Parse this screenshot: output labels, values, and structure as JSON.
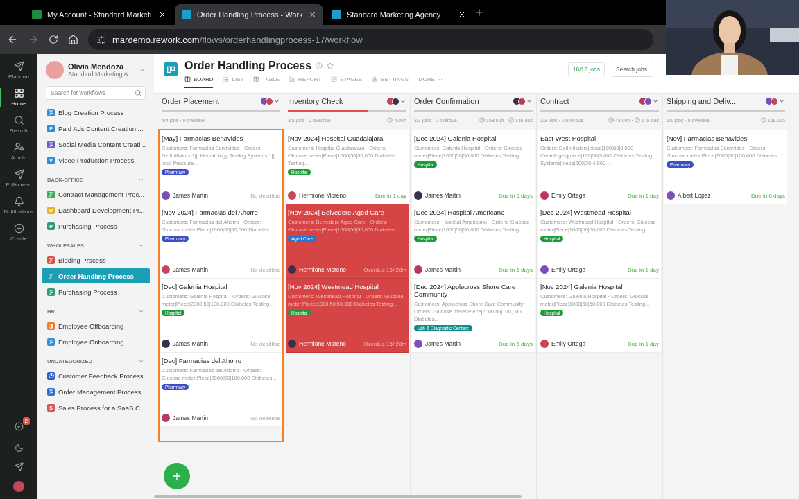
{
  "browser": {
    "tabs": [
      {
        "title": "My Account - Standard Marketi",
        "color": "#1e8e3e",
        "selected": false
      },
      {
        "title": "Order Handling Process - Work",
        "color": "#1a9fc9",
        "selected": true
      },
      {
        "title": "Standard Marketing Agency",
        "color": "#1a9fc9",
        "selected": false
      }
    ],
    "url_host": "mardemo.rework.com",
    "url_path": "/flows/orderhandlingprocess-17/workflow"
  },
  "rail": {
    "items": [
      {
        "label": "Platform",
        "kind": "send",
        "selected": false
      },
      {
        "label": "Home",
        "kind": "grid",
        "selected": true
      },
      {
        "label": "Search",
        "kind": "search",
        "selected": false
      },
      {
        "label": "Admin",
        "kind": "admin",
        "selected": false
      },
      {
        "label": "Fullscreen",
        "kind": "flag",
        "selected": false
      },
      {
        "label": "Notifications",
        "kind": "bell",
        "selected": false
      },
      {
        "label": "Create",
        "kind": "plus",
        "selected": false
      }
    ],
    "bottom": {
      "tasks_badge": "2"
    }
  },
  "sidebar": {
    "user": {
      "name": "Olivia Mendoza",
      "org": "Standard Marketing A..."
    },
    "search": {
      "placeholder": "Search for workflows"
    },
    "groups": [
      {
        "items": [
          {
            "label": "Blog Creation Process",
            "kind": "board",
            "color": "#2f8fd8",
            "selected": false
          },
          {
            "label": "Paid Ads Content Creation ...",
            "kind": "letter",
            "letter": "P",
            "color": "#2f8fd8",
            "selected": false
          },
          {
            "label": "Social Media Content Creati...",
            "kind": "board",
            "color": "#6e5cc8",
            "selected": false
          },
          {
            "label": "Video Production Process",
            "kind": "letter",
            "letter": "V",
            "color": "#2f8fd8",
            "selected": false
          }
        ]
      },
      {
        "title": "BACK-OFFICE",
        "items": [
          {
            "label": "Contract Management Proc...",
            "kind": "board",
            "color": "#3fae5a",
            "selected": false
          },
          {
            "label": "Dashboard Development Pr...",
            "kind": "letter",
            "letter": "D",
            "color": "#e6b420",
            "selected": false
          },
          {
            "label": "Purchasing Process",
            "kind": "letter",
            "letter": "P",
            "color": "#2a9d7e",
            "selected": false
          }
        ]
      },
      {
        "title": "WHOLESALES",
        "items": [
          {
            "label": "Bidding Process",
            "kind": "board",
            "color": "#d9534f",
            "selected": false
          },
          {
            "label": "Order Handling Process",
            "kind": "board",
            "color": "#1a9fb5",
            "selected": true
          },
          {
            "label": "Purchasing Process",
            "kind": "board",
            "color": "#2a9d7e",
            "selected": false
          }
        ]
      },
      {
        "title": "HR",
        "items": [
          {
            "label": "Employee Offboarding",
            "kind": "half",
            "color": "#f07a22",
            "selected": false
          },
          {
            "label": "Employee Onboarding",
            "kind": "board",
            "color": "#2f8fd8",
            "selected": false
          }
        ]
      },
      {
        "title": "UNCATEGORIZED",
        "items": [
          {
            "label": "Customer Feedback Process",
            "kind": "person",
            "color": "#2d5bb8",
            "selected": false
          },
          {
            "label": "Order Management Process",
            "kind": "board",
            "color": "#2d6fd0",
            "selected": false
          },
          {
            "label": "Sales Process for a SaaS C...",
            "kind": "letter",
            "letter": "S",
            "color": "#d9534f",
            "selected": false
          }
        ]
      }
    ]
  },
  "header": {
    "title": "Order Handling Process",
    "jobs_count": "16/16 jobs",
    "search": {
      "placeholder": "Search jobs"
    },
    "tabs": [
      {
        "label": "BOARD",
        "kind": "board",
        "selected": true
      },
      {
        "label": "LIST",
        "kind": "list",
        "selected": false
      },
      {
        "label": "TABLE",
        "kind": "table",
        "selected": false
      },
      {
        "label": "REPORT",
        "kind": "report",
        "selected": false
      },
      {
        "label": "STAGES",
        "kind": "stages",
        "selected": false
      },
      {
        "label": "SETTINGS",
        "kind": "gear",
        "selected": false
      },
      {
        "label": "MORE",
        "kind": "caret",
        "selected": false
      }
    ]
  },
  "columns": [
    {
      "title": "Order Placement",
      "highlighted": true,
      "jobs": "4/4 jobs · 0 overdue",
      "cards": [
        {
          "title": "[May] Farmacias Benavides",
          "summary": "Customers: Farmacias Benavides · Orders: Defibrillators|1||| Hematology Testing Systems|1||| lood Pressure...",
          "tag": {
            "label": "Pharmacy",
            "color": "#3d4fc4"
          },
          "assignee": "James Martin",
          "due": {
            "text": "No deadline",
            "kind": "none"
          },
          "overdue": false
        },
        {
          "title": "[Nov 2024] Farmacias del Ahorro",
          "summary": "Customers: Farmacias del Ahorro · Orders: Glucose meter|Piece|1000|50|50,000 Diabetes...",
          "tag": {
            "label": "Pharmacy",
            "color": "#3d4fc4"
          },
          "assignee": "James Martin",
          "due": {
            "text": "No deadline",
            "kind": "none"
          },
          "overdue": false
        },
        {
          "title": "[Dec] Galenia Hospital",
          "summary": "Customers: Galenia Hospital · Orders: Glucose meter|Piece|2000|50|100,000 Diabetes Testing...",
          "tag": {
            "label": "Hospital",
            "color": "#1f9a3a"
          },
          "assignee": "James Martin",
          "due": {
            "text": "No deadline",
            "kind": "none"
          },
          "overdue": false
        },
        {
          "title": "[Dec] Farmacias del Ahorro",
          "summary": "Customers: Farmacias del Ahorro · Orders: Glucose meter|Piece|2000|50|100,000 Diabetes...",
          "tag": {
            "label": "Pharmacy",
            "color": "#3d4fc4"
          },
          "assignee": "James Martin",
          "due": {
            "text": "No deadline",
            "kind": "none"
          },
          "overdue": false
        }
      ]
    },
    {
      "title": "Inventory Check",
      "highlighted": false,
      "progress": {
        "level": 0.67
      },
      "jobs": "3/3 jobs · 2 overdue",
      "hours": "4.00h",
      "cards": [
        {
          "title": "[Nov 2024] Hospital Guadalajara",
          "summary": "Customers: Hospital Guadalajara · Orders: Glucose meter|Piece|1000|50|50,000 Diabetes Testing...",
          "tag": {
            "label": "Hospital",
            "color": "#1f9a3a"
          },
          "assignee": "Hermione Moreno",
          "due": {
            "text": "Due in 1 day",
            "kind": "due"
          },
          "overdue": false
        },
        {
          "title": "[Nov 2024] Belvedere Aged Care",
          "summary": "Customers: Belvedere Aged Care · Orders: Glucose meter|Piece|1000|50|50,000 Diabetes...",
          "tag": {
            "label": "Aged Care",
            "color": "#1f78d1"
          },
          "assignee": "Hermione Moreno",
          "due": {
            "text": "Overdue 16h28m",
            "kind": "overdue"
          },
          "overdue": true
        },
        {
          "title": "[Nov 2024] Westmead Hospital",
          "summary": "Customers: Westmead Hospital · Orders: Glucose meter|Piece|1000|50|50,000 Diabetes Testing...",
          "tag": {
            "label": "Hospital",
            "color": "#1f9a3a"
          },
          "assignee": "Hermione Moreno",
          "due": {
            "text": "Overdue 16h28m",
            "kind": "overdue"
          },
          "overdue": true
        }
      ]
    },
    {
      "title": "Order Confirmation",
      "highlighted": false,
      "jobs": "3/3 jobs · 0 overdue",
      "hours": "168.00h ·",
      "todos": "1 to-dos",
      "cards": [
        {
          "title": "[Dec 2024] Galenia Hospital",
          "summary": "Customers: Galenia Hospital · Orders: Glucose meter|Piece|1000|50|50,000 Diabetes Testing...",
          "tag": {
            "label": "Hospital",
            "color": "#1f9a3a"
          },
          "assignee": "James Martin",
          "due": {
            "text": "Due in 6 days",
            "kind": "due"
          },
          "overdue": false
        },
        {
          "title": "[Dec 2024] Hospital Americano",
          "summary": "Customers: Hospital Americano · Orders: Glucose meter|Piece|1000|50|50,000 Diabetes Testing...",
          "tag": {
            "label": "Hospital",
            "color": "#1f9a3a"
          },
          "assignee": "James Martin",
          "due": {
            "text": "Due in 6 days",
            "kind": "due"
          },
          "overdue": false
        },
        {
          "title": "[Dec 2024] Applecross Shore Care Community",
          "summary": "Customers: Applecross Shore Care Community · Orders: Glucose meter|Piece|2000|50|100,000 Diabetes...",
          "tag": {
            "label": "Lab & Diagnostic Centers",
            "color": "#128a8a"
          },
          "assignee": "James Martin",
          "due": {
            "text": "Due in 6 days",
            "kind": "due"
          },
          "overdue": false
        }
      ]
    },
    {
      "title": "Contract",
      "highlighted": false,
      "jobs": "3/3 jobs · 0 overdue",
      "hours": "48.00h ·",
      "todos": "1 to-dos",
      "cards": [
        {
          "title": "East West Hospital",
          "summary": "Orders: Defibrillators|piece|100|80|8,000 Centrifuges|piece|100|50|5,000 Diabetes Testing Systems|piece|200|20|4,000...",
          "assignee": "Emily Ortega",
          "due": {
            "text": "Due in 1 day",
            "kind": "due"
          },
          "overdue": false
        },
        {
          "title": "[Dec 2024] Westmead Hospital",
          "summary": "Customers: Westmead Hospital · Orders: Glucose meter|Piece|1000|50|50,000 Diabetes Testing...",
          "tag": {
            "label": "Hospital",
            "color": "#1f9a3a"
          },
          "assignee": "Emily Ortega",
          "due": {
            "text": "Due in 1 day",
            "kind": "due"
          },
          "overdue": false
        },
        {
          "title": "[Nov 2024] Galenia Hospital",
          "summary": "Customers: Galenia Hospital · Orders: Glucose meter|Piece|1000|50|50,000 Diabetes Testing...",
          "tag": {
            "label": "Hospital",
            "color": "#1f9a3a"
          },
          "assignee": "Emily Ortega",
          "due": {
            "text": "Due in 1 day",
            "kind": "due"
          },
          "overdue": false
        }
      ]
    },
    {
      "title": "Shipping and Deliv...",
      "highlighted": false,
      "jobs": "1/1 jobs · 0 overdue",
      "hours": "168.00h",
      "cards": [
        {
          "title": "[Nov] Farmacias Benavides",
          "summary": "Customers: Farmacias Benavides · Orders: Glucose meter|Piece|2000|50|100,000 Diabetes...",
          "tag": {
            "label": "Pharmacy",
            "color": "#3d4fc4"
          },
          "assignee": "Albert López",
          "due": {
            "text": "Due in 6 days",
            "kind": "due"
          },
          "overdue": false
        }
      ]
    }
  ]
}
